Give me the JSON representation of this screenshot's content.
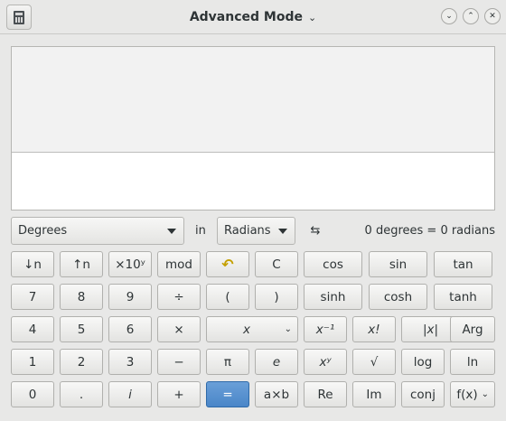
{
  "window": {
    "title": "Advanced Mode",
    "title_chevron": "⌄",
    "controls": {
      "minimize": "⌄",
      "maximize": "⌃",
      "close": "✕"
    }
  },
  "display": {
    "history": "",
    "input": ""
  },
  "conversion": {
    "from_unit": "Degrees",
    "in_label": "in",
    "to_unit": "Radians",
    "swap_glyph": "⇆",
    "result": "0 degrees  =  0 radians"
  },
  "keypad": {
    "rows": [
      [
        {
          "name": "shift-down-button",
          "label": "↓n"
        },
        {
          "name": "shift-up-button",
          "label": "↑n"
        },
        {
          "name": "exponent-button",
          "label": "×10ʸ"
        },
        {
          "name": "modulus-button",
          "label": "mod"
        },
        {
          "name": "undo-button",
          "label": "↶",
          "icon": true
        },
        {
          "name": "clear-button",
          "label": "C"
        },
        {
          "name": "cos-button",
          "label": "cos"
        },
        {
          "name": "sin-button",
          "label": "sin"
        },
        {
          "name": "tan-button",
          "label": "tan"
        }
      ],
      [
        {
          "name": "digit-7-button",
          "label": "7"
        },
        {
          "name": "digit-8-button",
          "label": "8"
        },
        {
          "name": "digit-9-button",
          "label": "9"
        },
        {
          "name": "divide-button",
          "label": "÷"
        },
        {
          "name": "open-paren-button",
          "label": "("
        },
        {
          "name": "close-paren-button",
          "label": ")"
        },
        {
          "name": "sinh-button",
          "label": "sinh"
        },
        {
          "name": "cosh-button",
          "label": "cosh"
        },
        {
          "name": "tanh-button",
          "label": "tanh"
        }
      ],
      [
        {
          "name": "digit-4-button",
          "label": "4"
        },
        {
          "name": "digit-5-button",
          "label": "5"
        },
        {
          "name": "digit-6-button",
          "label": "6"
        },
        {
          "name": "multiply-button",
          "label": "×"
        },
        {
          "name": "variable-x-dropdown",
          "label": "x",
          "italic": true,
          "dropdown": true
        },
        {
          "name": "inverse-button",
          "label": "x⁻¹",
          "italic": true
        },
        {
          "name": "factorial-button",
          "label": "x!",
          "italic": true
        },
        {
          "name": "absolute-button",
          "label": "|x|",
          "italic": true
        },
        {
          "name": "argument-button",
          "label": "Arg"
        }
      ],
      [
        {
          "name": "digit-1-button",
          "label": "1"
        },
        {
          "name": "digit-2-button",
          "label": "2"
        },
        {
          "name": "digit-3-button",
          "label": "3"
        },
        {
          "name": "subtract-button",
          "label": "−"
        },
        {
          "name": "pi-button",
          "label": "π"
        },
        {
          "name": "euler-button",
          "label": "e",
          "italic": true
        },
        {
          "name": "power-button",
          "label": "xʸ",
          "italic": true
        },
        {
          "name": "sqrt-button",
          "label": "√"
        },
        {
          "name": "log-button",
          "label": "log"
        },
        {
          "name": "ln-button",
          "label": "ln"
        }
      ],
      [
        {
          "name": "digit-0-button",
          "label": "0"
        },
        {
          "name": "decimal-point-button",
          "label": "."
        },
        {
          "name": "imaginary-button",
          "label": "i",
          "italic": true
        },
        {
          "name": "add-button",
          "label": "+"
        },
        {
          "name": "equals-button",
          "label": "=",
          "primary": true
        },
        {
          "name": "factor-button",
          "label": "a×b"
        },
        {
          "name": "real-part-button",
          "label": "Re"
        },
        {
          "name": "imaginary-part-button",
          "label": "Im"
        },
        {
          "name": "conjugate-button",
          "label": "conj"
        },
        {
          "name": "function-dropdown",
          "label": "f(x)",
          "dropdown": true
        }
      ]
    ]
  },
  "colors": {
    "accent": "#4a86c8",
    "undo_icon": "#c4a000",
    "background": "#e8e8e7"
  }
}
